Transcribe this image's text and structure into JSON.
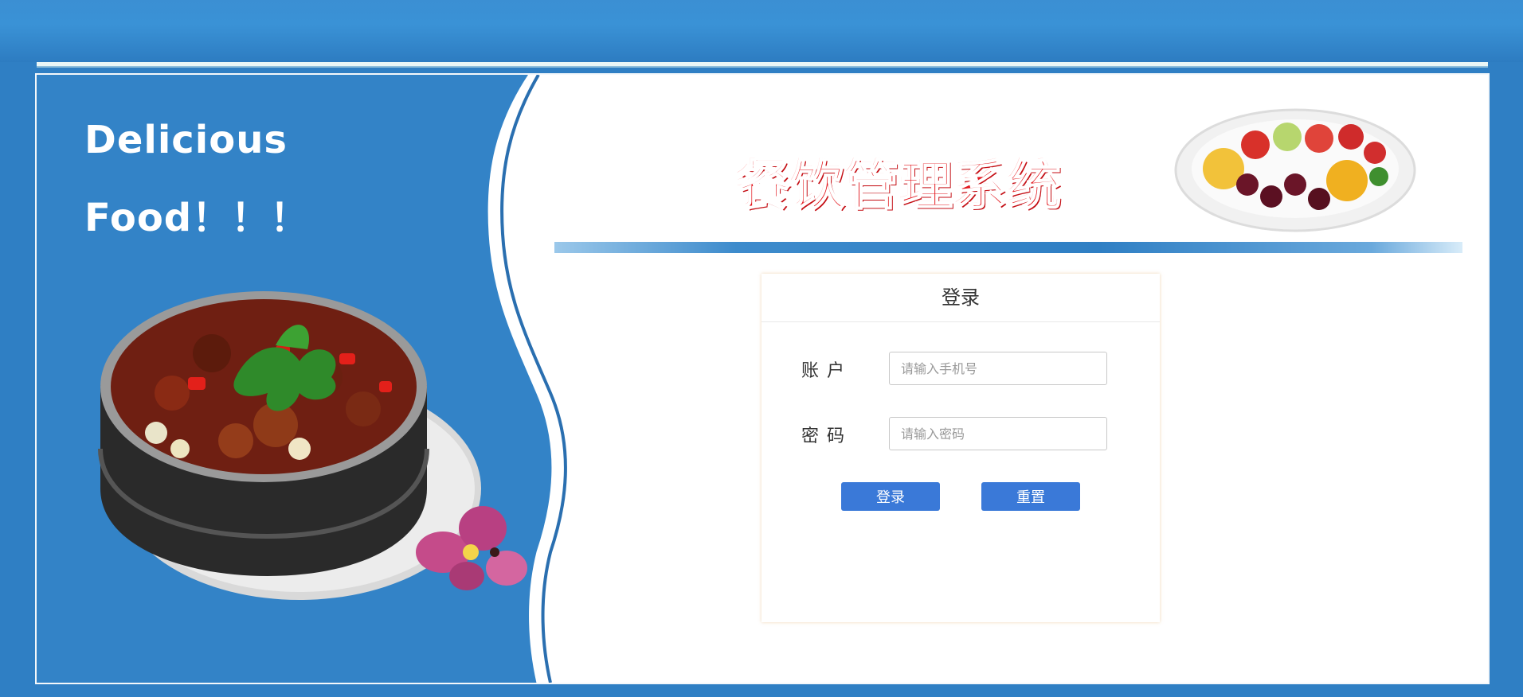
{
  "slogan": {
    "line1": "Delicious",
    "line2": "Food！！！"
  },
  "header": {
    "title": "餐饮管理系统"
  },
  "login": {
    "title": "登录",
    "account_label": "账户",
    "account_placeholder": "请输入手机号",
    "password_label": "密码",
    "password_placeholder": "请输入密码",
    "login_button": "登录",
    "reset_button": "重置"
  },
  "colors": {
    "background_blue": "#2f7fc4",
    "title_red": "#e3161c",
    "button_blue": "#3a79d8"
  },
  "images": {
    "left_dish": "braised-meat-pot-illustration",
    "flower": "orchid-illustration",
    "fruit_plate": "fruit-salad-plate-illustration"
  }
}
